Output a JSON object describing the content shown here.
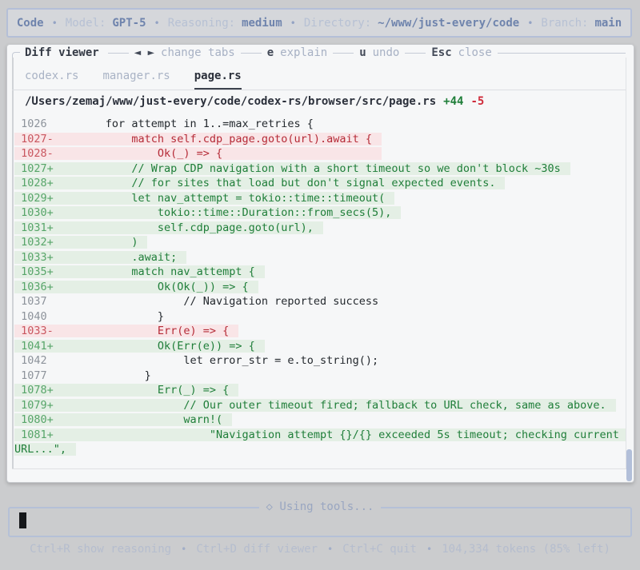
{
  "topbar": {
    "app": "Code",
    "separator": "•",
    "items": [
      {
        "label": "Model:",
        "value": "GPT-5"
      },
      {
        "label": "Reasoning:",
        "value": "medium"
      },
      {
        "label": "Directory:",
        "value": "~/www/just-every/code"
      },
      {
        "label": "Branch:",
        "value": "main"
      }
    ]
  },
  "diff_viewer": {
    "title": "Diff viewer",
    "shortcuts": [
      {
        "key": "◄ ►",
        "label": "change tabs"
      },
      {
        "key": "e",
        "label": "explain"
      },
      {
        "key": "u",
        "label": "undo"
      },
      {
        "key": "Esc",
        "label": "close"
      }
    ],
    "tabs": [
      {
        "label": "codex.rs",
        "active": false
      },
      {
        "label": "manager.rs",
        "active": false
      },
      {
        "label": "page.rs",
        "active": true
      }
    ],
    "file_path": "/Users/zemaj/www/just-every/code/codex-rs/browser/src/page.rs",
    "additions": "+44",
    "deletions": "-5",
    "lines": [
      {
        "num": "1026",
        "sign": "",
        "kind": "context",
        "text": "        for attempt in 1..=max_retries {"
      },
      {
        "num": "1027",
        "sign": "-",
        "kind": "removed",
        "text": "            match self.cdp_page.goto(url).await {"
      },
      {
        "num": "1028",
        "sign": "-",
        "kind": "removed",
        "text": "                Ok(_) => {"
      },
      {
        "num": "1027",
        "sign": "+",
        "kind": "added",
        "text": "            // Wrap CDP navigation with a short timeout so we don't block ~30s"
      },
      {
        "num": "1028",
        "sign": "+",
        "kind": "added",
        "text": "            // for sites that load but don't signal expected events."
      },
      {
        "num": "1029",
        "sign": "+",
        "kind": "added",
        "text": "            let nav_attempt = tokio::time::timeout("
      },
      {
        "num": "1030",
        "sign": "+",
        "kind": "added",
        "text": "                tokio::time::Duration::from_secs(5),"
      },
      {
        "num": "1031",
        "sign": "+",
        "kind": "added",
        "text": "                self.cdp_page.goto(url),"
      },
      {
        "num": "1032",
        "sign": "+",
        "kind": "added",
        "text": "            )"
      },
      {
        "num": "1033",
        "sign": "+",
        "kind": "added",
        "text": "            .await;"
      },
      {
        "num": "1035",
        "sign": "+",
        "kind": "added",
        "text": "            match nav_attempt {"
      },
      {
        "num": "1036",
        "sign": "+",
        "kind": "added",
        "text": "                Ok(Ok(_)) => {"
      },
      {
        "num": "1037",
        "sign": "",
        "kind": "context",
        "text": "                    // Navigation reported success"
      },
      {
        "num": "1040",
        "sign": "",
        "kind": "context",
        "text": "                }"
      },
      {
        "num": "1033",
        "sign": "-",
        "kind": "removed",
        "text": "                Err(e) => {"
      },
      {
        "num": "1041",
        "sign": "+",
        "kind": "added",
        "text": "                Ok(Err(e)) => {"
      },
      {
        "num": "1042",
        "sign": "",
        "kind": "context",
        "text": "                    let error_str = e.to_string();"
      },
      {
        "num": "1077",
        "sign": "",
        "kind": "context",
        "text": "              }"
      },
      {
        "num": "1078",
        "sign": "+",
        "kind": "added",
        "text": "                Err(_) => {"
      },
      {
        "num": "1079",
        "sign": "+",
        "kind": "added",
        "text": "                    // Our outer timeout fired; fallback to URL check, same as above."
      },
      {
        "num": "1080",
        "sign": "+",
        "kind": "added",
        "text": "                    warn!("
      },
      {
        "num": "1081",
        "sign": "+",
        "kind": "added",
        "text": "                        \"Navigation attempt {}/{} exceeded 5s timeout; checking current URL...\","
      }
    ]
  },
  "status": {
    "icon": "◇",
    "text": "Using tools..."
  },
  "footer": {
    "separator": "•",
    "items": [
      "Ctrl+R show reasoning",
      "Ctrl+D diff viewer",
      "Ctrl+C quit",
      "104,334 tokens (85% left)"
    ]
  },
  "colors": {
    "page_bg": "#cbccce",
    "panel_bg": "#f6f7f8",
    "accent_steel_blue": "#6f84ad",
    "added_bg": "#e4efe5",
    "added_text": "#1f7e39",
    "removed_bg": "#f9e5e7",
    "removed_text": "#b52b37",
    "muted_hint": "#a7b1c4"
  }
}
